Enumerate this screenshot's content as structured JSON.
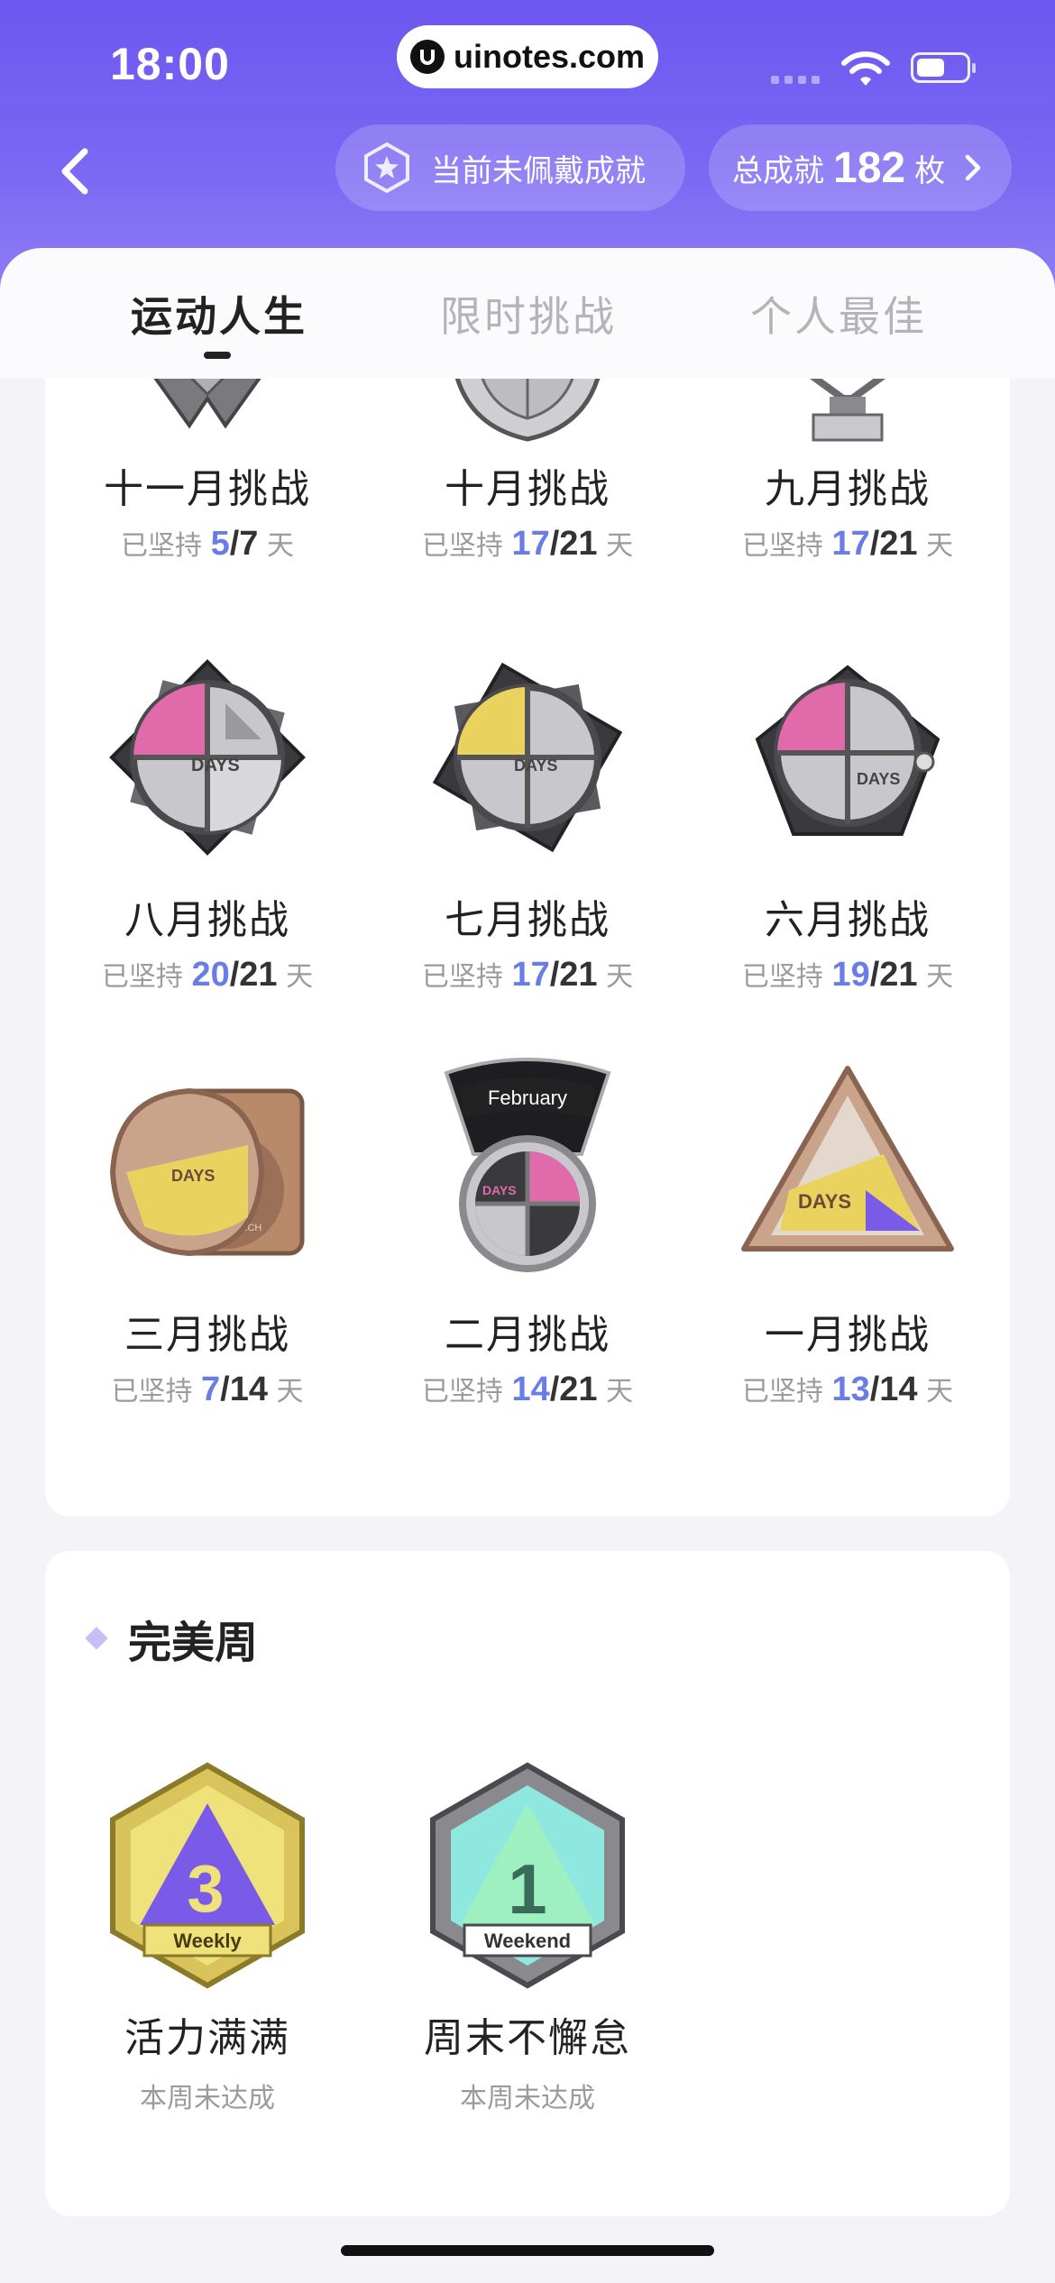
{
  "status_bar": {
    "time": "18:00",
    "url": "uinotes.com"
  },
  "header": {
    "equip_text": "当前未佩戴成就",
    "total_prefix": "总成就",
    "total_count": "182",
    "total_suffix": "枚"
  },
  "tabs": [
    {
      "label": "运动人生",
      "active": true
    },
    {
      "label": "限时挑战",
      "active": false
    },
    {
      "label": "个人最佳",
      "active": false
    }
  ],
  "challenges": [
    {
      "name": "十一月挑战",
      "prefix": "已坚持",
      "done": "5",
      "sep": "/",
      "total": "7",
      "unit": "天"
    },
    {
      "name": "十月挑战",
      "prefix": "已坚持",
      "done": "17",
      "sep": "/",
      "total": "21",
      "unit": "天"
    },
    {
      "name": "九月挑战",
      "prefix": "已坚持",
      "done": "17",
      "sep": "/",
      "total": "21",
      "unit": "天"
    },
    {
      "name": "八月挑战",
      "prefix": "已坚持",
      "done": "20",
      "sep": "/",
      "total": "21",
      "unit": "天",
      "badge_text": "DAYS"
    },
    {
      "name": "七月挑战",
      "prefix": "已坚持",
      "done": "17",
      "sep": "/",
      "total": "21",
      "unit": "天",
      "badge_text": "DAYS"
    },
    {
      "name": "六月挑战",
      "prefix": "已坚持",
      "done": "19",
      "sep": "/",
      "total": "21",
      "unit": "天",
      "badge_text": "DAYS"
    },
    {
      "name": "三月挑战",
      "prefix": "已坚持",
      "done": "7",
      "sep": "/",
      "total": "14",
      "unit": "天",
      "badge_text": "DAYS",
      "badge_small": "MARCH"
    },
    {
      "name": "二月挑战",
      "prefix": "已坚持",
      "done": "14",
      "sep": "/",
      "total": "21",
      "unit": "天",
      "badge_text": "DAYS",
      "ribbon": "February"
    },
    {
      "name": "一月挑战",
      "prefix": "已坚持",
      "done": "13",
      "sep": "/",
      "total": "14",
      "unit": "天",
      "badge_text": "DAYS"
    }
  ],
  "perfect_week": {
    "title": "完美周",
    "items": [
      {
        "name": "活力满满",
        "status": "本周未达成",
        "badge_text": "Weekly"
      },
      {
        "name": "周末不懈怠",
        "status": "本周未达成",
        "badge_text": "Weekend"
      }
    ]
  },
  "colors": {
    "header_purple": "#6d57f0",
    "done_blue": "#6a7ce8",
    "pink": "#e06aaa",
    "yellow": "#e9d35e",
    "violet": "#7a5be8",
    "teal": "#8fe8e0"
  }
}
